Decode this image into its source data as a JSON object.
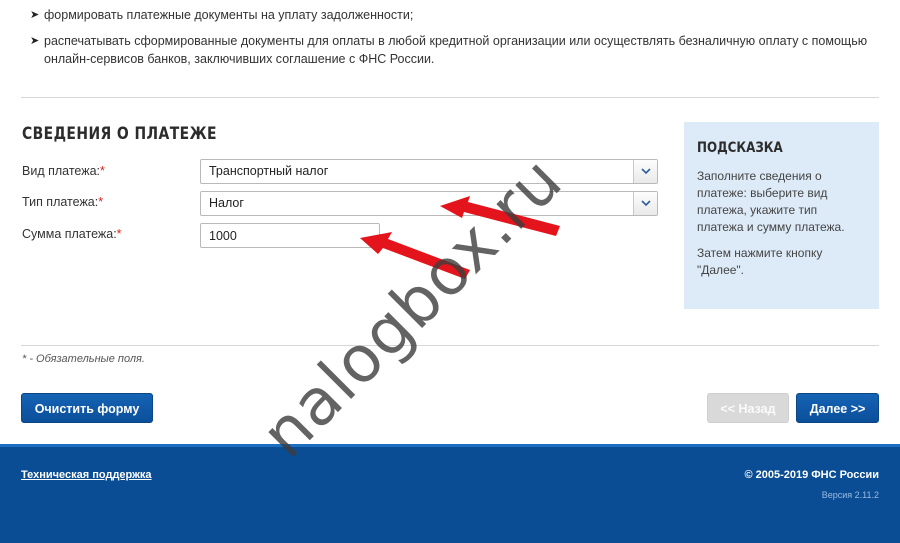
{
  "intro": {
    "items": [
      "формировать платежные документы на уплату задолженности;",
      "распечатывать сформированные документы для оплаты в любой кредитной организации или осуществлять безналичную оплату с помощью онлайн-сервисов банков, заключивших соглашение с ФНС России."
    ]
  },
  "form": {
    "title": "СВЕДЕНИЯ О ПЛАТЕЖЕ",
    "required_mark": "*",
    "payment_kind": {
      "label": "Вид платежа:",
      "value": "Транспортный налог"
    },
    "payment_type": {
      "label": "Тип платежа:",
      "value": "Налог"
    },
    "amount": {
      "label": "Сумма платежа:",
      "value": "1000"
    },
    "required_note": "* - Обязательные поля."
  },
  "hint": {
    "title": "ПОДСКАЗКА",
    "text1": "Заполните сведения о платеже: выберите вид платежа, укажите тип платежа и сумму платежа.",
    "text2": "Затем нажмите кнопку \"Далее\"."
  },
  "buttons": {
    "clear": "Очистить форму",
    "back": "<< Назад",
    "next": "Далее >>"
  },
  "footer": {
    "support": "Техническая поддержка",
    "copyright": "© 2005-2019 ФНС России",
    "version": "Версия 2.11.2"
  },
  "watermark": "nalogbox.ru",
  "colors": {
    "primary_button": "#0b4f9a",
    "footer": "#0a4d94",
    "hint_bg": "#ddeaf7",
    "required": "#d8211a",
    "annotation_arrow": "#e3141b"
  }
}
